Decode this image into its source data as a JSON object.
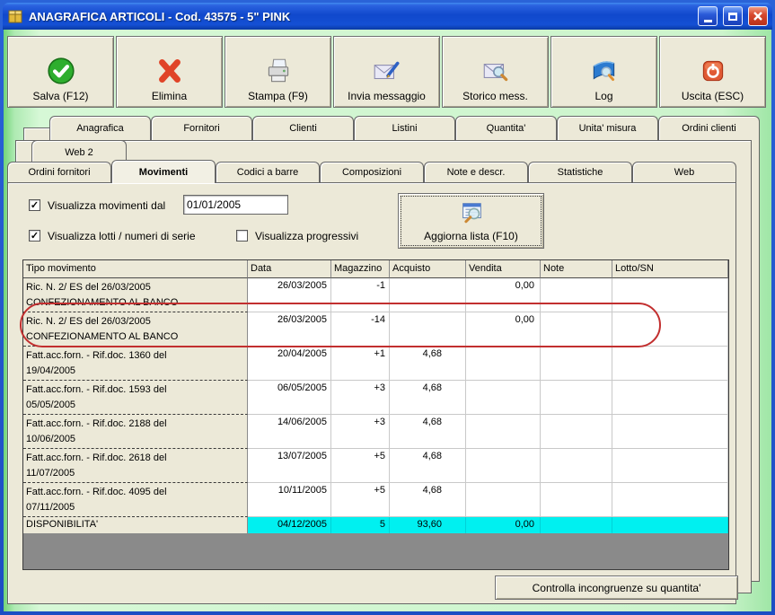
{
  "window": {
    "title": "ANAGRAFICA ARTICOLI - Cod. 43575 - 5\" PINK"
  },
  "icons": {
    "check": "✓"
  },
  "colors": {
    "titlebar_blue": "#1048cc",
    "panel_beige": "#ECE9D8",
    "client_green": "#ccf4cc",
    "availability_cyan": "#00F0F0",
    "highlight_red": "#c22f2f",
    "filler_gray": "#8a8a8a"
  },
  "toolbar": {
    "buttons": [
      {
        "label": "Salva (F12)",
        "icon": "check-circle-icon"
      },
      {
        "label": "Elimina",
        "icon": "red-x-icon"
      },
      {
        "label": "Stampa (F9)",
        "icon": "printer-icon"
      },
      {
        "label": "Invia messaggio",
        "icon": "mail-compose-icon"
      },
      {
        "label": "Storico mess.",
        "icon": "mail-search-icon"
      },
      {
        "label": "Log",
        "icon": "book-search-icon"
      },
      {
        "label": "Uscita (ESC)",
        "icon": "power-icon"
      }
    ]
  },
  "tabs": {
    "row1": [
      "Anagrafica",
      "Fornitori",
      "Clienti",
      "Listini",
      "Quantita'",
      "Unita' misura",
      "Ordini clienti"
    ],
    "row2": [
      "Web 2"
    ],
    "row3": [
      "Ordini fornitori",
      "Movimenti",
      "Codici a barre",
      "Composizioni",
      "Note e descr.",
      "Statistiche",
      "Web"
    ],
    "active": "Movimenti"
  },
  "filters": {
    "movimenti_dal_label": "Visualizza movimenti dal",
    "movimenti_dal_checked": true,
    "date_value": "01/01/2005",
    "lotti_label": "Visualizza lotti / numeri di serie",
    "lotti_checked": true,
    "progressivi_label": "Visualizza progressivi",
    "progressivi_checked": false
  },
  "buttons": {
    "aggiorna": "Aggiorna lista (F10)",
    "controlla": "Controlla incongruenze su quantita'"
  },
  "table": {
    "columns": [
      "Tipo movimento",
      "Data",
      "Magazzino",
      "Acquisto",
      "Vendita",
      "Note",
      "Lotto/SN"
    ],
    "rows": [
      {
        "tipo": "Ric. N. 2/ ES del 26/03/2005\nCONFEZIONAMENTO AL BANCO",
        "data": "26/03/2005",
        "magazzino": "-1",
        "acquisto": "",
        "vendita": "0,00",
        "note": "",
        "lotto": ""
      },
      {
        "tipo": "Ric. N. 2/ ES del 26/03/2005\nCONFEZIONAMENTO AL BANCO",
        "data": "26/03/2005",
        "magazzino": "-14",
        "acquisto": "",
        "vendita": "0,00",
        "note": "",
        "lotto": "",
        "highlighted": true
      },
      {
        "tipo": "Fatt.acc.forn. - Rif.doc. 1360 del\n19/04/2005",
        "data": "20/04/2005",
        "magazzino": "+1",
        "acquisto": "4,68",
        "vendita": "",
        "note": "",
        "lotto": ""
      },
      {
        "tipo": "Fatt.acc.forn. - Rif.doc. 1593 del\n05/05/2005",
        "data": "06/05/2005",
        "magazzino": "+3",
        "acquisto": "4,68",
        "vendita": "",
        "note": "",
        "lotto": ""
      },
      {
        "tipo": "Fatt.acc.forn. - Rif.doc. 2188 del\n10/06/2005",
        "data": "14/06/2005",
        "magazzino": "+3",
        "acquisto": "4,68",
        "vendita": "",
        "note": "",
        "lotto": ""
      },
      {
        "tipo": "Fatt.acc.forn. - Rif.doc. 2618 del\n11/07/2005",
        "data": "13/07/2005",
        "magazzino": "+5",
        "acquisto": "4,68",
        "vendita": "",
        "note": "",
        "lotto": ""
      },
      {
        "tipo": "Fatt.acc.forn. - Rif.doc. 4095 del\n07/11/2005",
        "data": "10/11/2005",
        "magazzino": "+5",
        "acquisto": "4,68",
        "vendita": "",
        "note": "",
        "lotto": ""
      }
    ],
    "disponibilita": {
      "tipo": "DISPONIBILITA'",
      "data": "04/12/2005",
      "magazzino": "5",
      "acquisto": "93,60",
      "vendita": "0,00",
      "note": "",
      "lotto": ""
    }
  }
}
